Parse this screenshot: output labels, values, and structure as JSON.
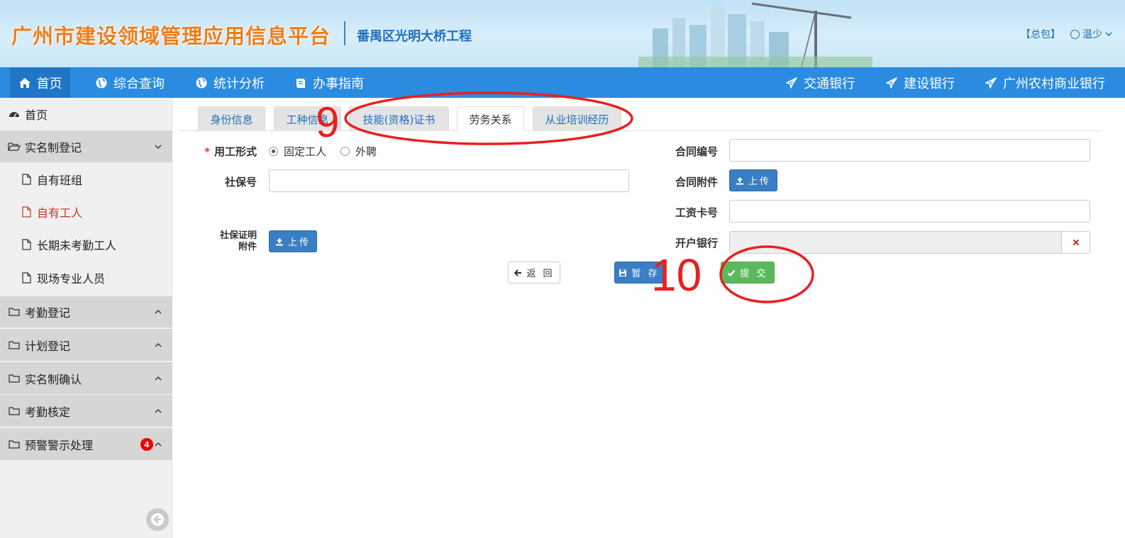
{
  "header": {
    "app_title": "广州市建设领域管理应用信息平台",
    "project_name": "番禺区光明大桥工程",
    "role": "【总包】",
    "username": "温少"
  },
  "nav": {
    "items": [
      {
        "label": "首页",
        "icon": "home-icon"
      },
      {
        "label": "综合查询",
        "icon": "globe-icon"
      },
      {
        "label": "统计分析",
        "icon": "globe-icon"
      },
      {
        "label": "办事指南",
        "icon": "book-icon"
      }
    ],
    "banks": [
      {
        "label": "交通银行",
        "icon": "send-icon"
      },
      {
        "label": "建设银行",
        "icon": "send-icon"
      },
      {
        "label": "广州农村商业银行",
        "icon": "send-icon"
      }
    ]
  },
  "sidebar": {
    "home": "首页",
    "realname_group": "实名制登记",
    "sub_items": [
      "自有班组",
      "自有工人",
      "长期未考勤工人",
      "现场专业人员"
    ],
    "groups": [
      "考勤登记",
      "计划登记",
      "实名制确认",
      "考勤核定",
      "预警警示处理"
    ],
    "warning_count": "4"
  },
  "tabs": [
    "身份信息",
    "工种信息",
    "技能(资格)证书",
    "劳务关系",
    "从业培训经历"
  ],
  "form": {
    "employment_type_label": "用工形式",
    "required_mark": "*",
    "option_fixed": "固定工人",
    "option_outsourced": "外聘",
    "social_security_label": "社保号",
    "social_security_value": "",
    "ss_cert_label_line1": "社保证明",
    "ss_cert_label_line2": "附件",
    "upload_label": "上传",
    "contract_no_label": "合同编号",
    "contract_no_value": "",
    "contract_attachment_label": "合同附件",
    "salary_card_label": "工资卡号",
    "salary_card_value": "",
    "bank_label": "开户银行",
    "bank_value": ""
  },
  "actions": {
    "back": "返 回",
    "save_draft": "暂 存",
    "submit": "提 交"
  },
  "annotations": {
    "step9": "9",
    "step10": "10",
    "color": "#e8201f"
  }
}
